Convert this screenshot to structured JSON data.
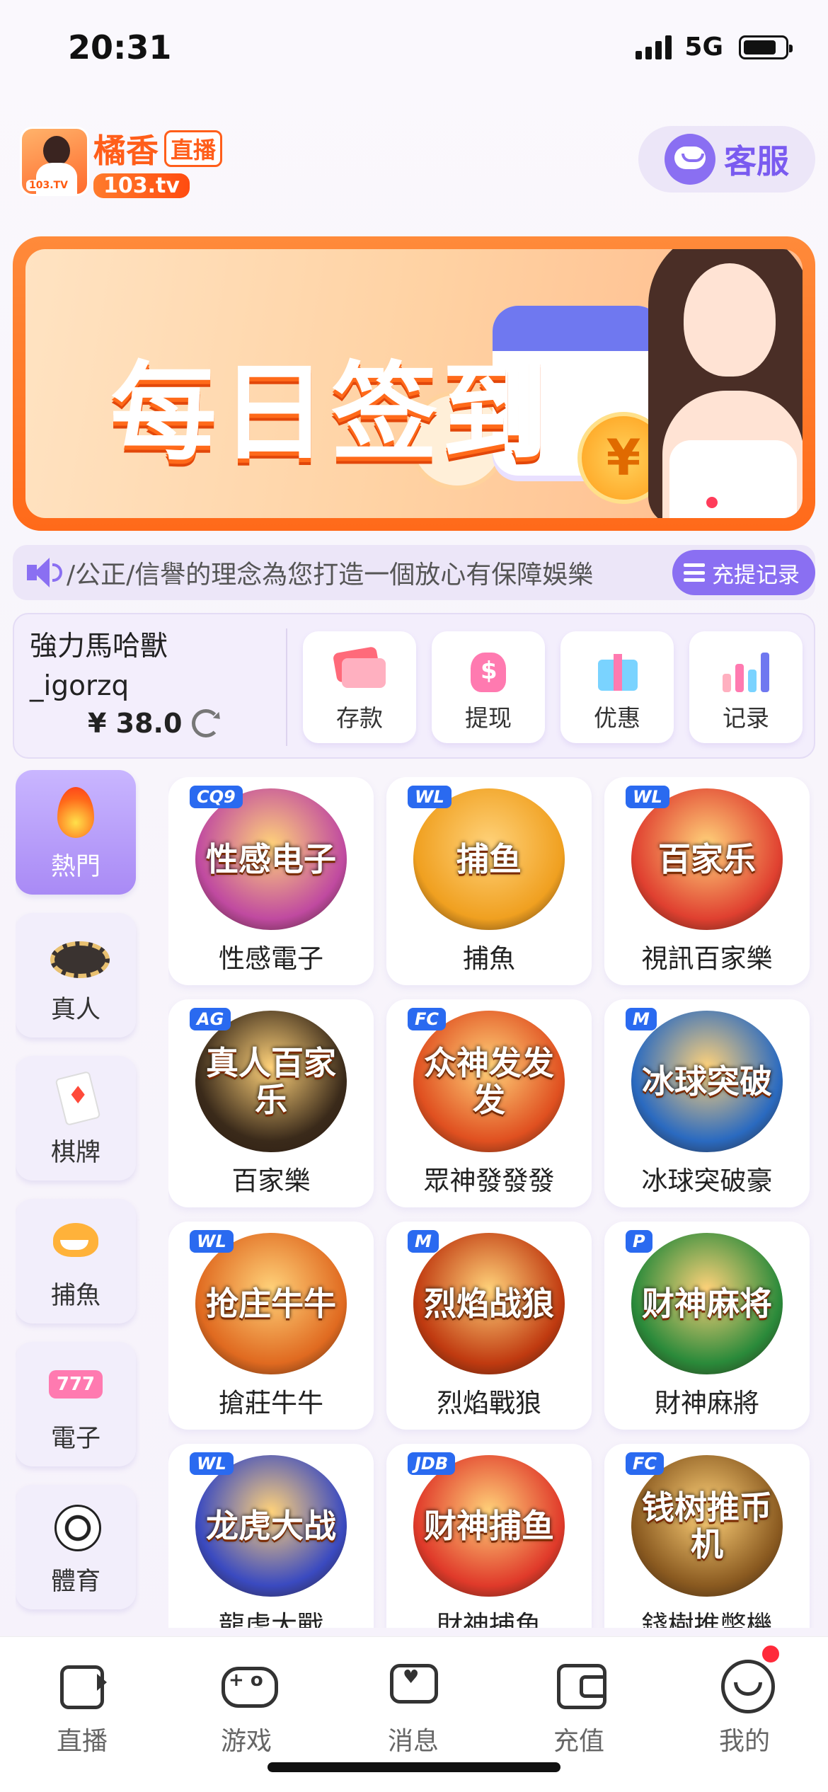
{
  "status": {
    "time": "20:31",
    "network": "5G"
  },
  "header": {
    "logo_brand": "橘香",
    "logo_live": "直播",
    "logo_domain": "103.tv",
    "logo_tag": "103.TV",
    "cs_label": "客服"
  },
  "banner": {
    "title": "每日签到",
    "coin_symbol": "¥",
    "slides": 4,
    "active_slide": 0
  },
  "marquee": {
    "text": "/公正/信譽的理念為您打造一個放心有保障娛樂",
    "record_label": "充提记录"
  },
  "account": {
    "user_line1": "強力馬哈獸",
    "user_line2": "_igorzq",
    "balance": "¥ 38.0",
    "actions": [
      {
        "label": "存款",
        "icon": "card-icon"
      },
      {
        "label": "提现",
        "icon": "money-bag-icon"
      },
      {
        "label": "优惠",
        "icon": "gift-icon"
      },
      {
        "label": "记录",
        "icon": "bar-chart-icon"
      }
    ]
  },
  "categories": [
    {
      "label": "熱門",
      "icon": "fire-icon",
      "active": true
    },
    {
      "label": "真人",
      "icon": "chip-icon"
    },
    {
      "label": "棋牌",
      "icon": "poker-card-icon"
    },
    {
      "label": "捕魚",
      "icon": "shark-icon"
    },
    {
      "label": "電子",
      "icon": "slot-machine-icon"
    },
    {
      "label": "體育",
      "icon": "soccer-ball-icon"
    }
  ],
  "games": [
    {
      "name": "性感電子",
      "art": "性感电子",
      "badge": "CQ9",
      "color": "#c04aa0"
    },
    {
      "name": "捕魚",
      "art": "捕鱼",
      "badge": "WL",
      "color": "#f0a020"
    },
    {
      "name": "視訊百家樂",
      "art": "百家乐",
      "badge": "WL",
      "color": "#e04030"
    },
    {
      "name": "百家樂",
      "art": "真人百家乐",
      "badge": "AG",
      "color": "#3a2a1a"
    },
    {
      "name": "眾神發發發",
      "art": "众神发发发",
      "badge": "FC",
      "color": "#e05020"
    },
    {
      "name": "冰球突破豪",
      "art": "冰球突破",
      "badge": "M",
      "color": "#2a6ac0"
    },
    {
      "name": "搶莊牛牛",
      "art": "抢庄牛牛",
      "badge": "WL",
      "color": "#e06a20"
    },
    {
      "name": "烈焰戰狼",
      "art": "烈焰战狼",
      "badge": "M",
      "color": "#c03a10"
    },
    {
      "name": "財神麻將",
      "art": "财神麻将",
      "badge": "P",
      "color": "#2a8a3a"
    },
    {
      "name": "龍虎大戰",
      "art": "龙虎大战",
      "badge": "WL",
      "color": "#3a4ac0"
    },
    {
      "name": "財神捕魚",
      "art": "财神捕鱼",
      "badge": "JDB",
      "color": "#e03a2a"
    },
    {
      "name": "錢樹推幣機",
      "art": "钱树推币机",
      "badge": "FC",
      "color": "#8a5a20"
    }
  ],
  "tabs": [
    {
      "label": "直播",
      "icon": "tv-icon"
    },
    {
      "label": "游戏",
      "icon": "gamepad-icon"
    },
    {
      "label": "消息",
      "icon": "message-icon"
    },
    {
      "label": "充值",
      "icon": "wallet-icon"
    },
    {
      "label": "我的",
      "icon": "profile-icon"
    }
  ],
  "colors": {
    "accent": "#8a6ff2",
    "brand": "#ff5e1a",
    "notification": "#ff2a3a"
  }
}
